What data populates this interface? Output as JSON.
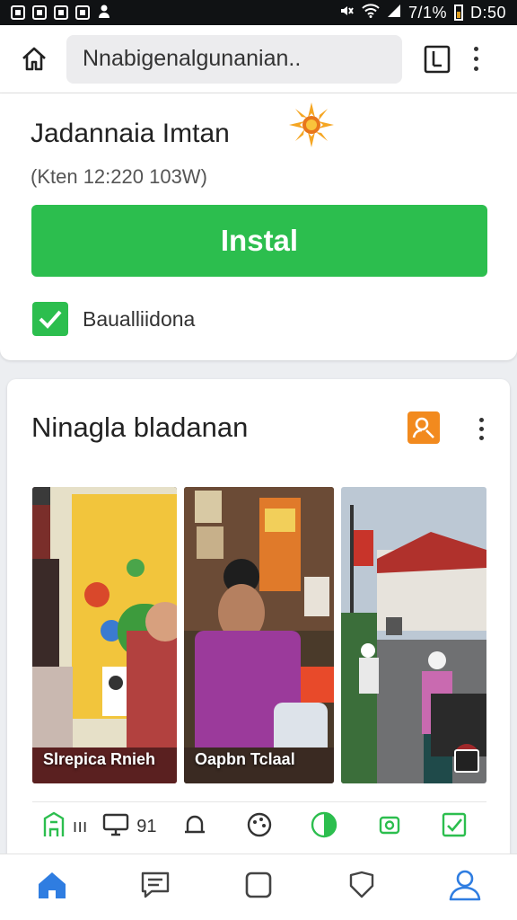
{
  "status_bar": {
    "battery_text": "7/1%",
    "time": "D:50",
    "left_icons": [
      "notification-icon",
      "photo-icon",
      "image-icon",
      "gallery-icon",
      "person-icon"
    ],
    "right_icons": [
      "mute-icon",
      "wifi-icon",
      "signal-icon",
      "battery-icon"
    ]
  },
  "browser": {
    "url_text": "Nnabigenalgunanian..",
    "icons": [
      "home-icon",
      "tabs-icon",
      "more-vert-icon"
    ]
  },
  "app_card": {
    "title": "Jadannaia Imtan",
    "meta": "(Kten 12:220 103W)",
    "install_label": "Instal",
    "checkbox_label": "Baualliidona",
    "checkbox_checked": true,
    "accent_color": "#2cbe4e"
  },
  "section": {
    "title": "Ninagla bladanan",
    "badge_color": "#f28a1e",
    "photos": [
      {
        "caption": "Slrepica Rnieh"
      },
      {
        "caption": "Oapbn Tclaal"
      },
      {
        "caption": ""
      }
    ],
    "strip": [
      {
        "icon": "building-icon",
        "text": "ııı"
      },
      {
        "icon": "monitor-icon",
        "text": "91"
      },
      {
        "icon": "bell-icon",
        "text": ""
      },
      {
        "icon": "palette-icon",
        "text": ""
      },
      {
        "icon": "pie-icon",
        "text": ""
      },
      {
        "icon": "camera-icon",
        "text": ""
      },
      {
        "icon": "edit-check-icon",
        "text": ""
      }
    ]
  },
  "bottom_nav": {
    "items": [
      "home-icon",
      "chat-icon",
      "square-icon",
      "shield-icon",
      "profile-icon"
    ],
    "active_color": "#2f7de1"
  }
}
